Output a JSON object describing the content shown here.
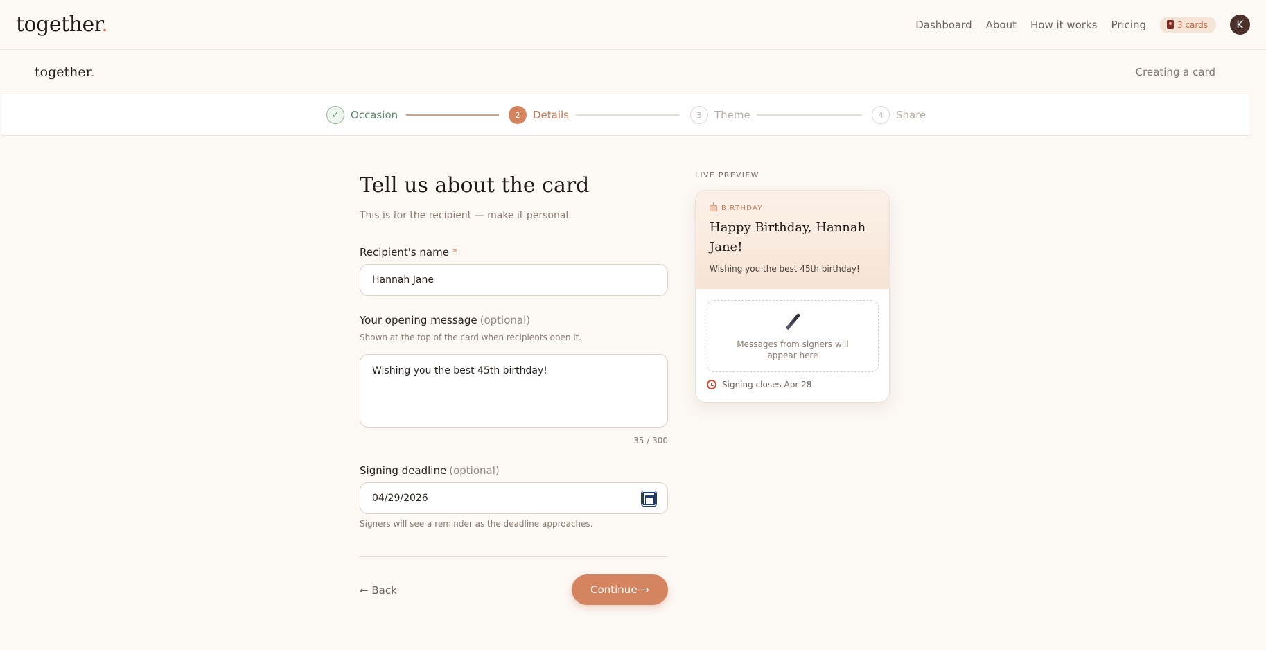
{
  "nav": {
    "logo_text": "together",
    "logo_dot": ".",
    "links": [
      "Dashboard",
      "About",
      "How it works",
      "Pricing"
    ],
    "cards_pill": "3 cards",
    "avatar_initial": "K"
  },
  "subheader": {
    "logo_text": "together",
    "logo_dot": ".",
    "status": "Creating a card"
  },
  "stepper": {
    "steps": [
      {
        "number": "✓",
        "label": "Occasion",
        "state": "done"
      },
      {
        "number": "2",
        "label": "Details",
        "state": "active"
      },
      {
        "number": "3",
        "label": "Theme",
        "state": "todo"
      },
      {
        "number": "4",
        "label": "Share",
        "state": "todo"
      }
    ]
  },
  "form": {
    "title": "Tell us about the card",
    "subtitle": "This is for the recipient — make it personal.",
    "recipient": {
      "label": "Recipient's name",
      "required_mark": "*",
      "value": "Hannah Jane"
    },
    "message": {
      "label": "Your opening message",
      "optional": "(optional)",
      "help": "Shown at the top of the card when recipients open it.",
      "value": "Wishing you the best 45th birthday!",
      "counter": "35 / 300"
    },
    "deadline": {
      "label": "Signing deadline",
      "optional": "(optional)",
      "value": "04/29/2026",
      "help": "Signers will see a reminder as the deadline approaches."
    },
    "back_label": "← Back",
    "continue_label": "Continue →"
  },
  "preview": {
    "section_label": "LIVE PREVIEW",
    "occasion": "BIRTHDAY",
    "title": "Happy Birthday, Hannah Jane!",
    "message": "Wishing you the best 45th birthday!",
    "signers_placeholder": "Messages from signers will appear here",
    "deadline_text": "Signing closes Apr 28"
  },
  "colors": {
    "accent": "#d4845f",
    "background": "#fcf8f4",
    "done_green": "#5c8a6a"
  }
}
